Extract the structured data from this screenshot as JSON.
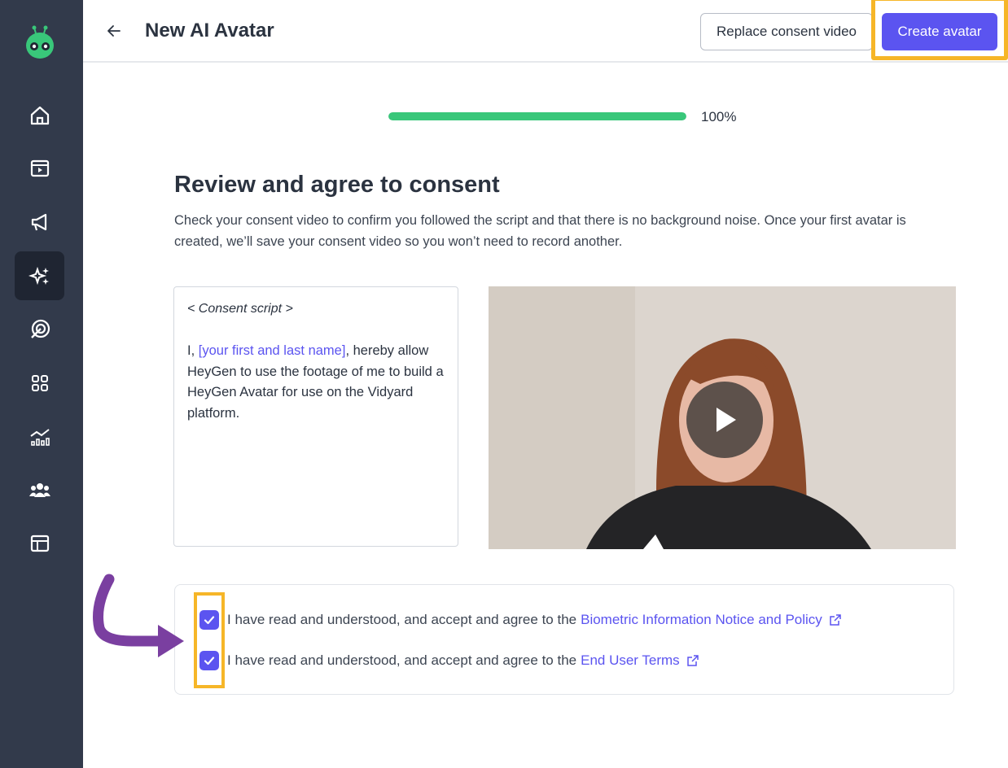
{
  "sidebar": {
    "logo": "robot-logo",
    "items": [
      {
        "name": "home-icon"
      },
      {
        "name": "video-library-icon"
      },
      {
        "name": "megaphone-icon"
      },
      {
        "name": "ai-sparkle-icon",
        "active": true
      },
      {
        "name": "target-icon"
      },
      {
        "name": "apps-grid-icon"
      },
      {
        "name": "analytics-icon"
      },
      {
        "name": "people-icon"
      },
      {
        "name": "layout-icon"
      }
    ]
  },
  "header": {
    "title": "New AI Avatar",
    "replace_label": "Replace consent video",
    "create_label": "Create avatar"
  },
  "progress": {
    "value": 1.0,
    "label": "100%"
  },
  "main": {
    "title": "Review and agree to consent",
    "description": "Check your consent video to confirm you followed the script and that there is no background noise. Once your first avatar is created, we’ll save your consent video so you won’t need to record another.",
    "script": {
      "heading": "< Consent script >",
      "prefix": "I, ",
      "placeholder": "[your first and last name]",
      "suffix": ", hereby allow HeyGen to use the footage of me to build a HeyGen Avatar for use on the Vidyard platform."
    }
  },
  "consents": [
    {
      "text": "I have read and understood, and accept and agree to the",
      "link": "Biometric Information Notice and Policy",
      "checked": true
    },
    {
      "text": "I have read and understood, and accept and agree to the",
      "link": "End User Terms",
      "checked": true
    }
  ],
  "colors": {
    "sidebar": "#323a4b",
    "accent": "#5b54f0",
    "progress": "#39c77a",
    "highlight": "#f6b628",
    "annotation_arrow": "#7a3fa0"
  }
}
